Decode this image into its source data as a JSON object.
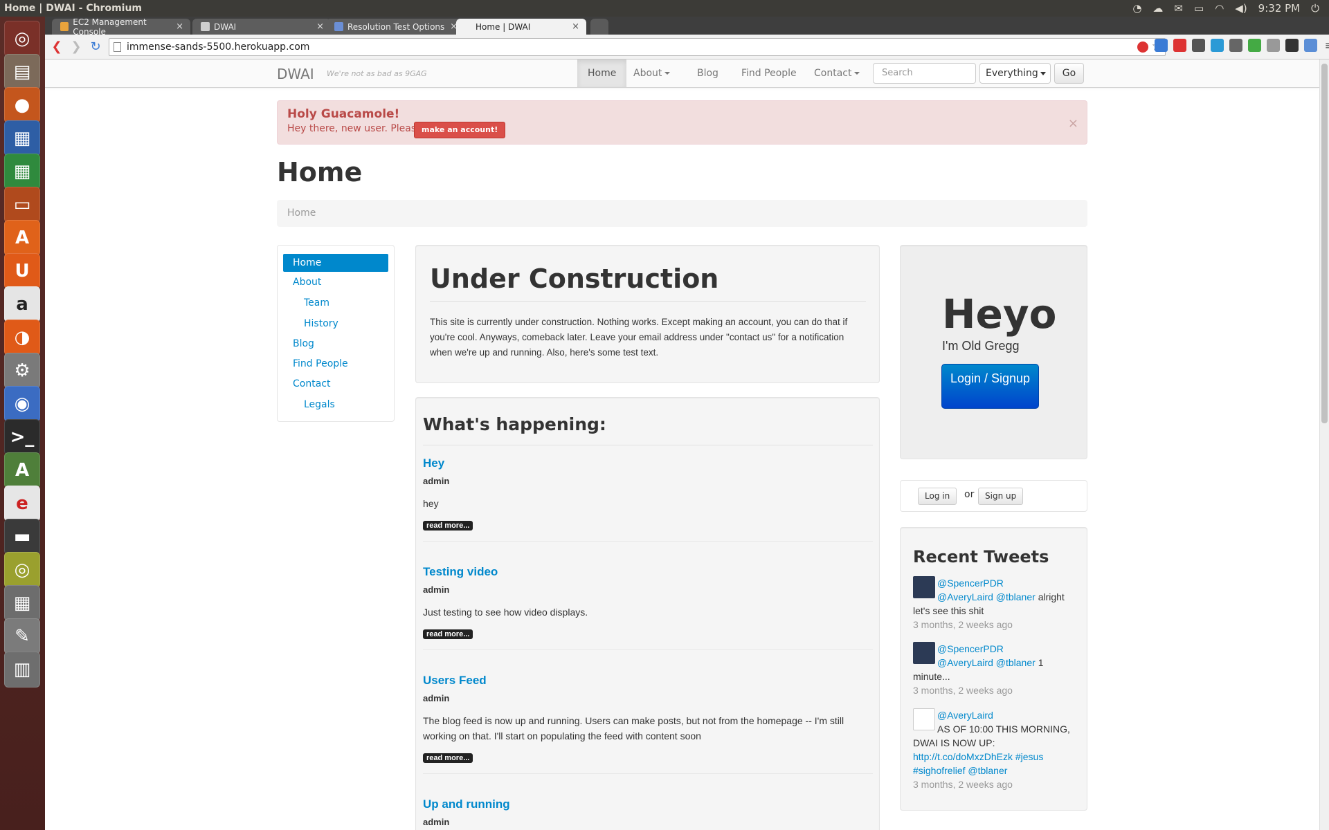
{
  "window_title": "Home | DWAI - Chromium",
  "system": {
    "clock": "9:32 PM"
  },
  "tabs": [
    {
      "label": "EC2 Management Console",
      "color": "#e8a33c"
    },
    {
      "label": "DWAI",
      "color": "#cfcfcf"
    },
    {
      "label": "Resolution Test Options",
      "color": "#6b8fd6"
    },
    {
      "label": "Home | DWAI",
      "color": "#ffffff"
    }
  ],
  "url": "immense-sands-5500.herokuapp.com",
  "site": {
    "brand": "DWAI",
    "tagline": "We're not as bad as 9GAG",
    "nav": {
      "home": "Home",
      "about": "About",
      "blog": "Blog",
      "find_people": "Find People",
      "contact": "Contact"
    },
    "search_placeholder": "Search",
    "scope": "Everything",
    "go": "Go"
  },
  "alert": {
    "heading": "Holy Guacamole!",
    "text": "Hey there, new user. Please",
    "button": "make an account!",
    "close": "×"
  },
  "page_title": "Home",
  "breadcrumb": "Home",
  "sidebar": {
    "items": [
      {
        "label": "Home"
      },
      {
        "label": "About"
      },
      {
        "label": "Team"
      },
      {
        "label": "History"
      },
      {
        "label": "Blog"
      },
      {
        "label": "Find People"
      },
      {
        "label": "Contact"
      },
      {
        "label": "Legals"
      }
    ]
  },
  "construction": {
    "title": "Under Construction",
    "body": "This site is currently under construction. Nothing works. Except making an account, you can do that if you're cool. Anyways, comeback later. Leave your email address under \"contact us\" for a notification when we're up and running. Also, here's some test text."
  },
  "feed": {
    "heading": "What's happening:",
    "read_more": "read more...",
    "posts": [
      {
        "title": "Hey",
        "author": "admin",
        "body": "hey"
      },
      {
        "title": "Testing video",
        "author": "admin",
        "body": "Just testing to see how video displays."
      },
      {
        "title": "Users Feed",
        "author": "admin",
        "body": "The blog feed is now up and running. Users can make posts, but not from the homepage -- I'm still working on that. I'll start on populating the feed with content soon"
      },
      {
        "title": "Up and running",
        "author": "admin"
      }
    ]
  },
  "hero": {
    "big": "Heyo",
    "sub": "I'm Old Gregg",
    "button": "Login / Signup"
  },
  "auth": {
    "login": "Log in",
    "or": "or",
    "signup": "Sign up"
  },
  "tweets": {
    "heading": "Recent Tweets",
    "items": [
      {
        "user": "@SpencerPDR",
        "mentions": "@AveryLaird @tblaner",
        "text": "alright let's see this shit",
        "time": "3 months, 2 weeks ago"
      },
      {
        "user": "@SpencerPDR",
        "mentions": "@AveryLaird @tblaner",
        "text": "1 minute...",
        "time": "3 months, 2 weeks ago"
      },
      {
        "user": "@AveryLaird",
        "text": "AS OF 10:00 THIS MORNING, DWAI IS NOW UP:",
        "link": "http://t.co/doMxzDhEzk",
        "tags": "#jesus #sighofrelief",
        "mention2": "@tblaner",
        "time": "3 months, 2 weeks ago"
      }
    ]
  }
}
